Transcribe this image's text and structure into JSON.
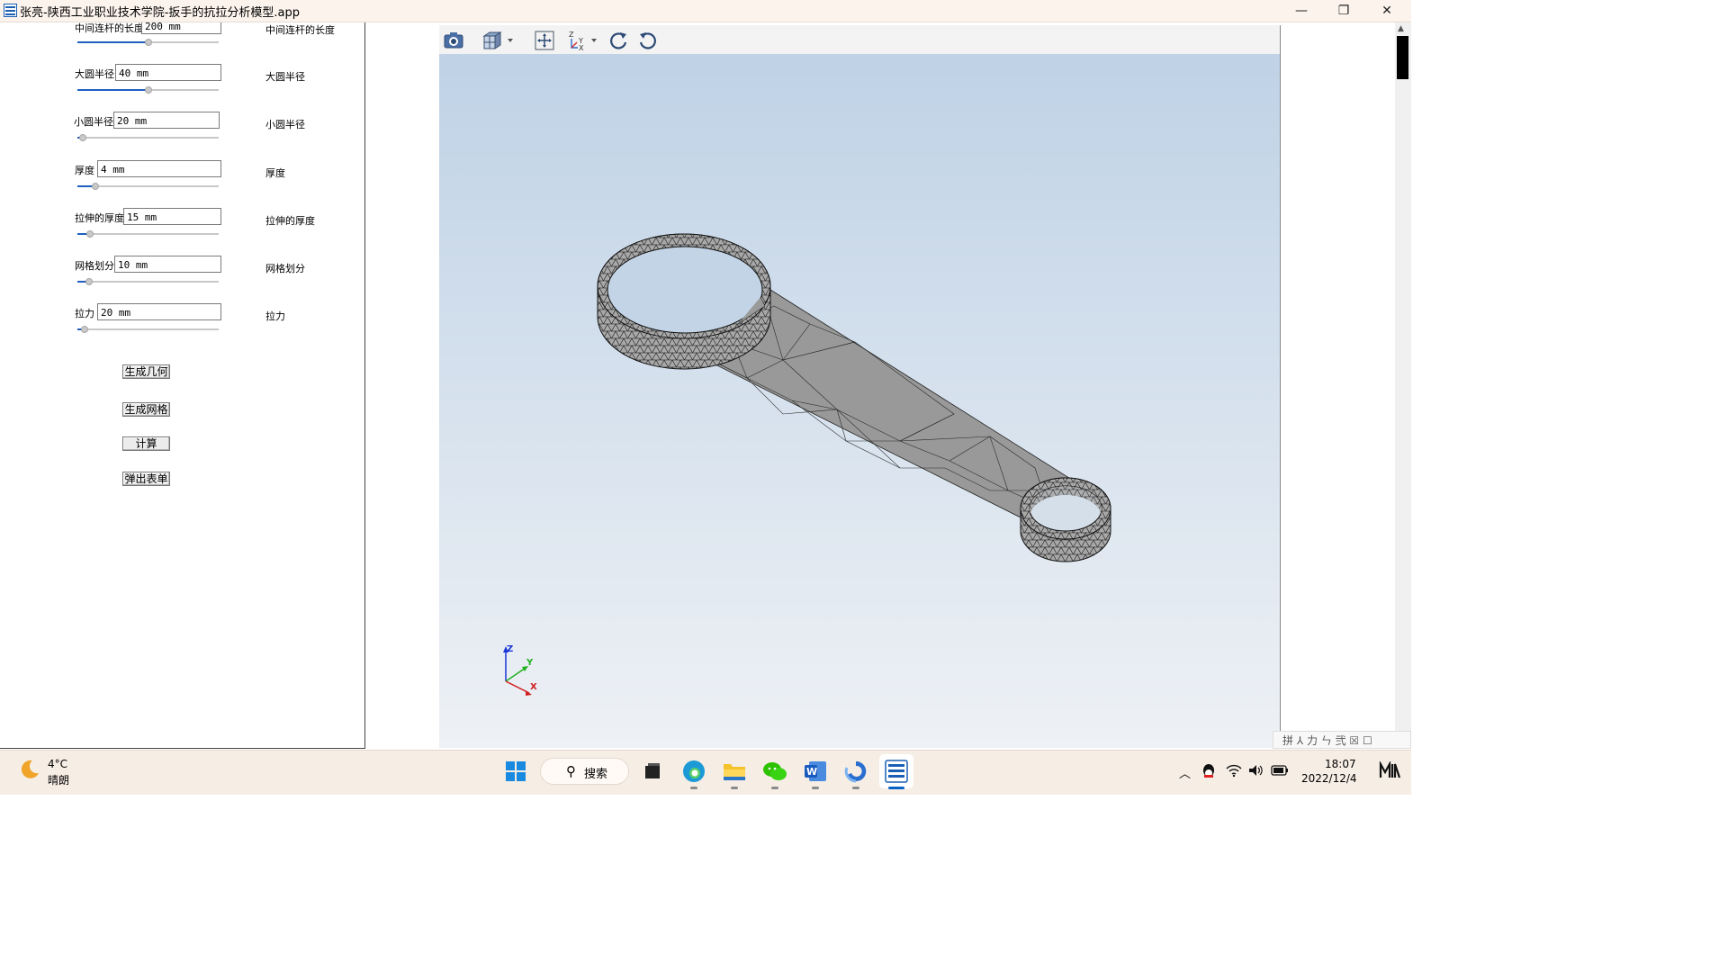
{
  "window": {
    "title": "张亮-陕西工业职业技术学院-扳手的抗拉分析模型.app",
    "minimize_glyph": "—",
    "restore_glyph": "❐",
    "close_glyph": "✕"
  },
  "params": [
    {
      "label": "中间连杆的长度",
      "value": "200  mm",
      "right_label": "中间连杆的长度",
      "slider_fraction": 0.5
    },
    {
      "label": "大圆半径",
      "value": "40  mm",
      "right_label": "大圆半径",
      "slider_fraction": 0.5
    },
    {
      "label": "小圆半径",
      "value": "20  mm",
      "right_label": "小圆半径",
      "slider_fraction": 0.04
    },
    {
      "label": "厚度",
      "value": "4  mm",
      "right_label": "厚度",
      "slider_fraction": 0.13
    },
    {
      "label": "拉伸的厚度",
      "value": "15  mm",
      "right_label": "拉伸的厚度",
      "slider_fraction": 0.09
    },
    {
      "label": "网格划分",
      "value": "10  mm",
      "right_label": "网格划分",
      "slider_fraction": 0.08
    },
    {
      "label": "拉力",
      "value": "20  mm",
      "right_label": "拉力",
      "slider_fraction": 0.05
    }
  ],
  "buttons": {
    "geometry": "生成几何",
    "mesh": "生成网格",
    "compute": "计算",
    "popup": "弹出表单"
  },
  "toolbar": {
    "icons": [
      "camera-icon",
      "view-cube-icon",
      "zoom-extents-icon",
      "axis-orientation-icon",
      "rotate-cw-icon",
      "rotate-ccw-icon"
    ]
  },
  "axes": {
    "z": "Z",
    "y": "Y",
    "x": "X"
  },
  "ime": {
    "text": "拼 ⅄ 力 ㄣ 弐 ☒ ☐"
  },
  "taskbar": {
    "weather_temp": "4°C",
    "weather_desc": "晴朗",
    "search_label": "搜索",
    "time": "18:07",
    "date": "2022/12/4"
  },
  "colors": {
    "accent": "#1f5fbf",
    "model_fill": "#9a9a9a",
    "viewport_top": "#bfd2e6",
    "viewport_bottom": "#eef1f5"
  }
}
